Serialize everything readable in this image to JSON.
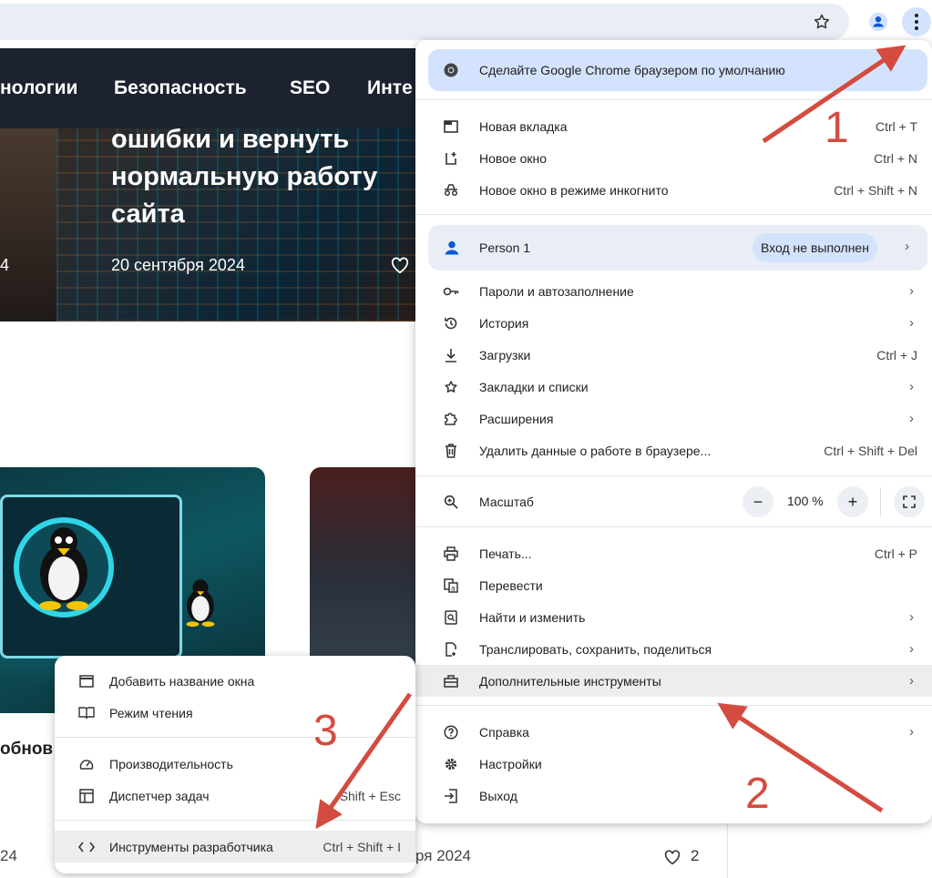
{
  "toolbar": {
    "bookmark_icon": "star-icon",
    "profile_icon": "person-icon",
    "menu_icon": "kebab-menu-icon"
  },
  "site": {
    "nav": [
      "нологии",
      "Безопасность",
      "SEO",
      "Инте"
    ],
    "hero_title": "ошибки и вернуть нормальную работу сайта",
    "hero_date": "20 сентября 2024",
    "hero_left_num": "4",
    "card_left_title_fragment": "обнов",
    "card_left_date_fragment": "24",
    "card_right_date_fragment": "ря 2024",
    "card_right_likes": "2"
  },
  "chrome_menu": {
    "promo": "Сделайте Google Chrome браузером по умолчанию",
    "new_tab": {
      "label": "Новая вкладка",
      "shortcut": "Ctrl + T"
    },
    "new_window": {
      "label": "Новое окно",
      "shortcut": "Ctrl + N"
    },
    "incognito": {
      "label": "Новое окно в режиме инкогнито",
      "shortcut": "Ctrl + Shift + N"
    },
    "person": {
      "name": "Person 1",
      "status": "Вход не выполнен"
    },
    "passwords": {
      "label": "Пароли и автозаполнение"
    },
    "history": {
      "label": "История"
    },
    "downloads": {
      "label": "Загрузки",
      "shortcut": "Ctrl + J"
    },
    "bookmarks": {
      "label": "Закладки и списки"
    },
    "extensions": {
      "label": "Расширения"
    },
    "clear_data": {
      "label": "Удалить данные о работе в браузере...",
      "shortcut": "Ctrl + Shift + Del"
    },
    "zoom": {
      "label": "Масштаб",
      "value": "100 %",
      "minus": "−",
      "plus": "+"
    },
    "print": {
      "label": "Печать...",
      "shortcut": "Ctrl + P"
    },
    "translate": {
      "label": "Перевести"
    },
    "find": {
      "label": "Найти и изменить"
    },
    "cast": {
      "label": "Транслировать, сохранить, поделиться"
    },
    "more_tools": {
      "label": "Дополнительные инструменты"
    },
    "help": {
      "label": "Справка"
    },
    "settings": {
      "label": "Настройки"
    },
    "exit": {
      "label": "Выход"
    }
  },
  "sub_menu": {
    "name_window": {
      "label": "Добавить название окна"
    },
    "reading_mode": {
      "label": "Режим чтения"
    },
    "performance": {
      "label": "Производительность"
    },
    "task_manager": {
      "label": "Диспетчер задач",
      "shortcut": "Shift + Esc"
    },
    "dev_tools": {
      "label": "Инструменты разработчика",
      "shortcut": "Ctrl + Shift + I"
    }
  },
  "annotations": {
    "step1": "1",
    "step2": "2",
    "step3": "3",
    "color": "#d44b3f"
  }
}
